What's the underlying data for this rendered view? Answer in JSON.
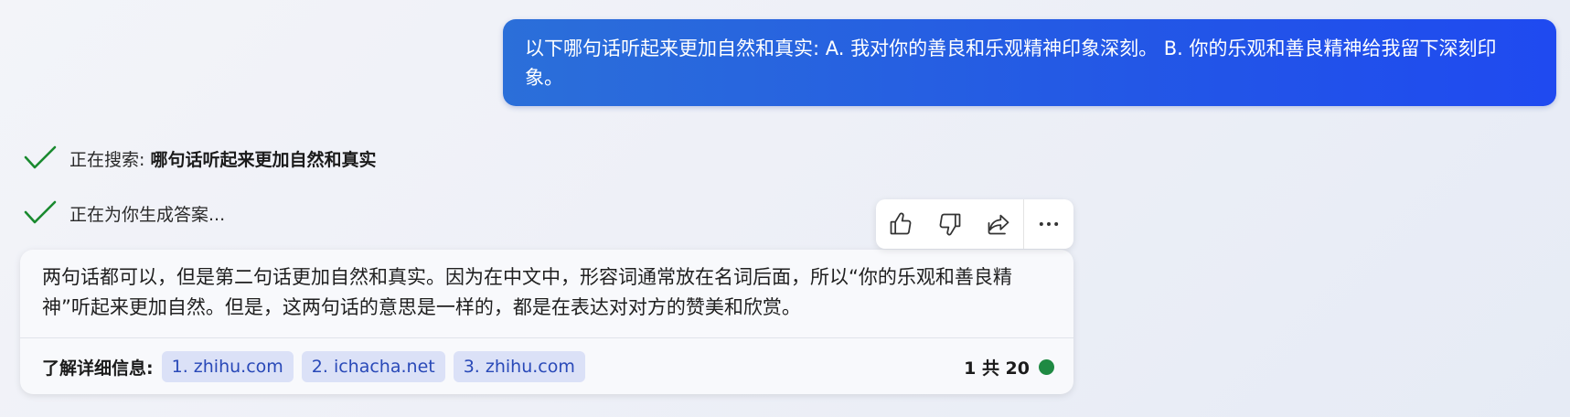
{
  "user_message": {
    "text": "以下哪句话听起来更加自然和真实: A. 我对你的善良和乐观精神印象深刻。 B. 你的乐观和善良精神给我留下深刻印象。"
  },
  "status": {
    "searching_prefix": "正在搜索: ",
    "searching_query": "哪句话听起来更加自然和真实",
    "generating": "正在为你生成答案..."
  },
  "actions": {
    "icons": [
      "thumbs-up-icon",
      "thumbs-down-icon",
      "share-icon",
      "more-icon"
    ]
  },
  "answer": {
    "text": "两句话都可以，但是第二句话更加自然和真实。因为在中文中，形容词通常放在名词后面，所以“你的乐观和善良精神”听起来更加自然。但是，这两句话的意思是一样的，都是在表达对对方的赞美和欣赏。",
    "sources_label": "了解详细信息:",
    "sources": [
      {
        "label": "1. zhihu.com"
      },
      {
        "label": "2. ichacha.net"
      },
      {
        "label": "3. zhihu.com"
      }
    ],
    "page_count": "1 共 20"
  },
  "colors": {
    "user_bubble": "#2357e6",
    "check": "#1a8a2f",
    "chip_bg": "#dbe1f7",
    "chip_text": "#2949b8",
    "status_dot": "#1f8a43"
  }
}
